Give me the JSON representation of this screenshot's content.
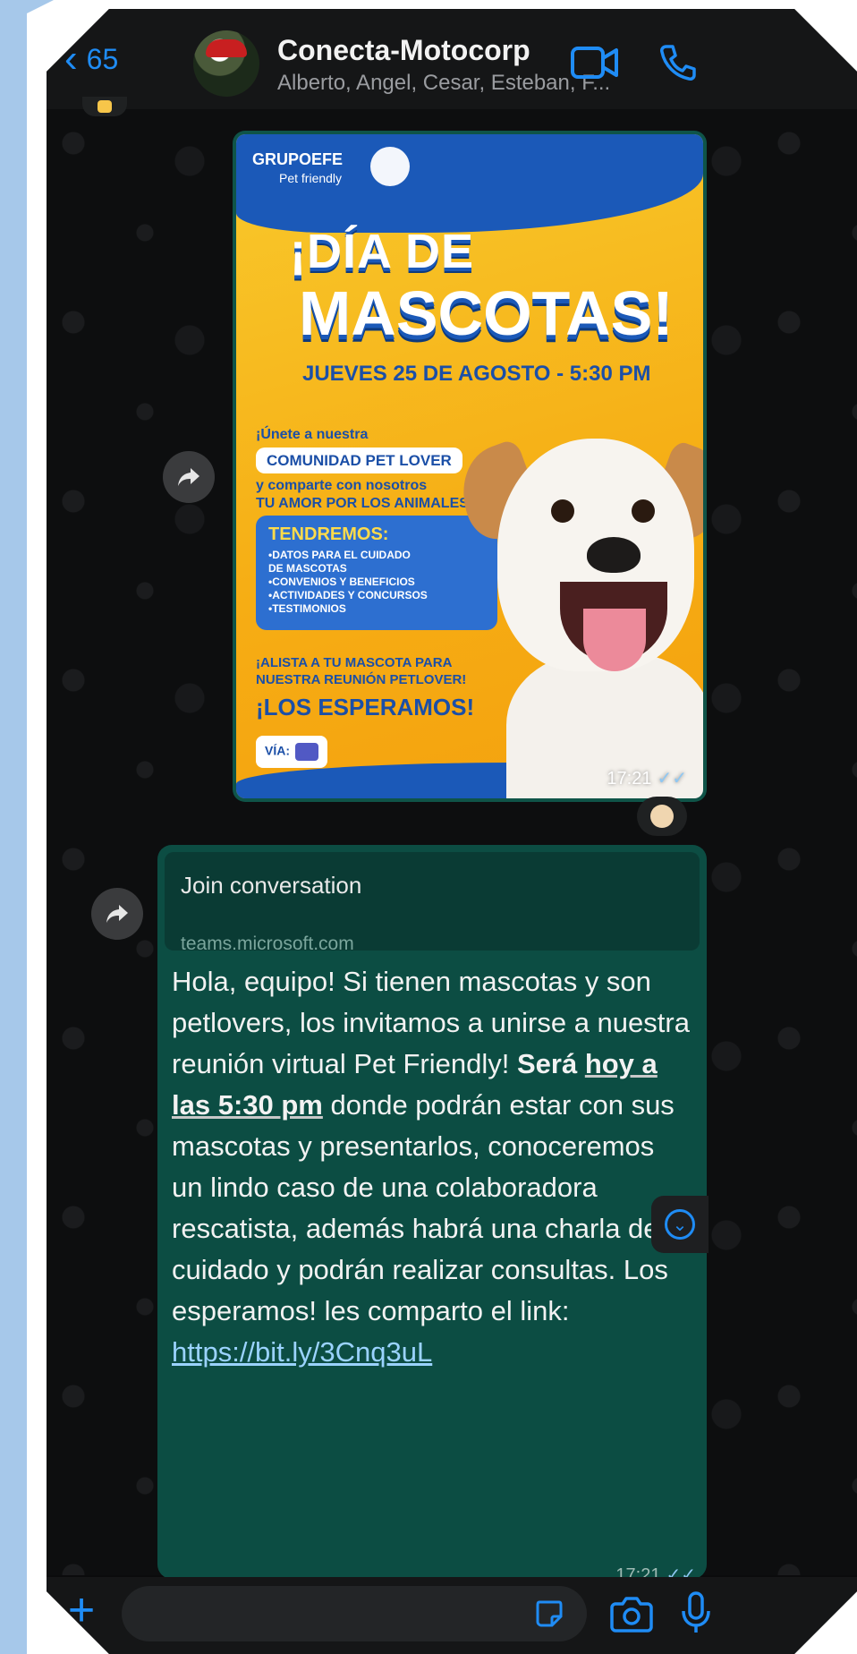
{
  "header": {
    "back_count": "65",
    "title": "Conecta-Motocorp",
    "subtitle": "Alberto, Angel, Cesar, Esteban, F..."
  },
  "icons": {
    "back": "chevron-left-icon",
    "video": "video-call-icon",
    "call": "phone-icon",
    "forward": "forward-icon",
    "scroll": "chevron-down-icon",
    "attach": "plus-icon",
    "sticker": "sticker-icon",
    "camera": "camera-icon",
    "mic": "microphone-icon"
  },
  "colors": {
    "accent": "#1f8cf5",
    "outgoing_bubble": "#0c4d43",
    "chat_bg": "#0d0e0f"
  },
  "poster": {
    "brand": "GRUPOEFE",
    "brand_sub": "Pet friendly",
    "headline1": "¡DÍA DE",
    "headline2": "MASCOTAS!",
    "date": "JUEVES 25 DE AGOSTO - 5:30 PM",
    "join_line1": "¡Únete a nuestra",
    "join_pill": "COMUNIDAD PET LOVER",
    "join_line2": "y comparte con nosotros",
    "join_line3": "TU AMOR POR LOS ANIMALES!",
    "box_title": "TENDREMOS:",
    "box_items": [
      "•DATOS PARA EL CUIDADO",
      "DE MASCOTAS",
      "•CONVENIOS Y BENEFICIOS",
      "•ACTIVIDADES Y CONCURSOS",
      "•TESTIMONIOS"
    ],
    "alista_line1": "¡ALISTA A TU MASCOTA PARA",
    "alista_line2": "NUESTRA REUNIÓN PETLOVER!",
    "alista_big": "¡LOS ESPERAMOS!",
    "via": "VÍA:"
  },
  "image_message": {
    "time": "17:21"
  },
  "text_message": {
    "preview_title": "Join conversation",
    "preview_url": "teams.microsoft.com",
    "part1": "Hola, equipo! Si tienen mascotas y son petlovers, los invitamos a unirse a nuestra reunión virtual Pet Friendly!  ",
    "bold1": "Será ",
    "bold_u1": "hoy a las 5:30 pm",
    "part2": " donde podrán estar con sus mascotas y presentarlos, conoceremos un lindo caso de una colaboradora rescatista, además habrá una charla de cuidado y podrán realizar consultas. Los esperamos! les comparto el link: ",
    "link": "https://bit.ly/3Cnq3uL",
    "time": "17:21"
  },
  "footer": {
    "input_value": ""
  }
}
